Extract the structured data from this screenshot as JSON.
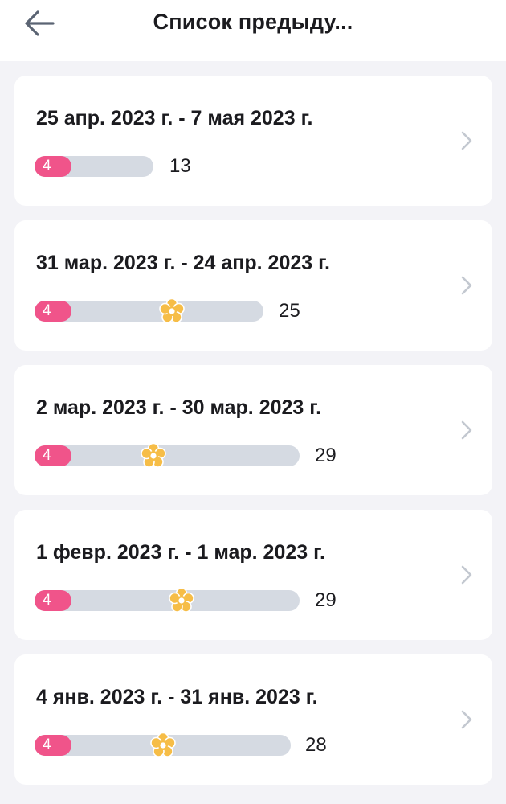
{
  "header": {
    "title": "Список предыду..."
  },
  "colors": {
    "accent": "#f0548a",
    "track": "#d5dae2",
    "ovulation": "#f6bd47",
    "background": "#f3f3f7"
  },
  "cycles": [
    {
      "dates": "25 апр. 2023 г. - 7 мая 2023 г.",
      "period_days": "4",
      "cycle_length": "13",
      "has_ovulation": false
    },
    {
      "dates": "31 мар. 2023 г. - 24 апр. 2023 г.",
      "period_days": "4",
      "cycle_length": "25",
      "has_ovulation": true
    },
    {
      "dates": "2 мар. 2023 г. - 30 мар. 2023 г.",
      "period_days": "4",
      "cycle_length": "29",
      "has_ovulation": true
    },
    {
      "dates": "1 февр. 2023 г. - 1 мар. 2023 г.",
      "period_days": "4",
      "cycle_length": "29",
      "has_ovulation": true
    },
    {
      "dates": "4 янв. 2023 г. - 31 янв. 2023 г.",
      "period_days": "4",
      "cycle_length": "28",
      "has_ovulation": true
    }
  ]
}
